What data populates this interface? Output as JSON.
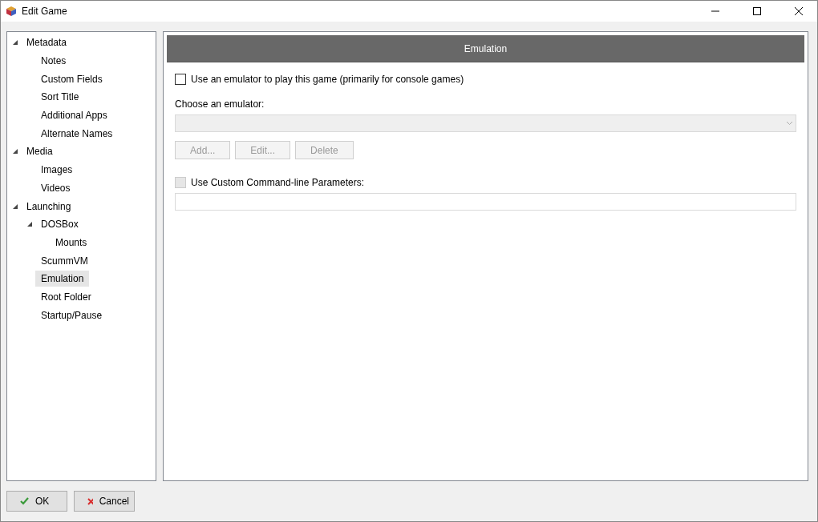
{
  "window": {
    "title": "Edit Game"
  },
  "tree": [
    {
      "label": "Metadata",
      "selected": false,
      "expanded": true,
      "children": [
        {
          "label": "Notes",
          "selected": false
        },
        {
          "label": "Custom Fields",
          "selected": false
        },
        {
          "label": "Sort Title",
          "selected": false
        },
        {
          "label": "Additional Apps",
          "selected": false
        },
        {
          "label": "Alternate Names",
          "selected": false
        }
      ]
    },
    {
      "label": "Media",
      "selected": false,
      "expanded": true,
      "children": [
        {
          "label": "Images",
          "selected": false
        },
        {
          "label": "Videos",
          "selected": false
        }
      ]
    },
    {
      "label": "Launching",
      "selected": false,
      "expanded": true,
      "children": [
        {
          "label": "DOSBox",
          "selected": false,
          "expanded": true,
          "children": [
            {
              "label": "Mounts",
              "selected": false
            }
          ]
        },
        {
          "label": "ScummVM",
          "selected": false
        },
        {
          "label": "Emulation",
          "selected": true
        },
        {
          "label": "Root Folder",
          "selected": false
        },
        {
          "label": "Startup/Pause",
          "selected": false
        }
      ]
    }
  ],
  "panel": {
    "header": "Emulation",
    "use_emulator": {
      "label": "Use an emulator to play this game (primarily for console games)",
      "checked": false,
      "disabled": false
    },
    "choose_label": "Choose an emulator:",
    "emulator_select": {
      "disabled": true
    },
    "buttons": [
      {
        "label": "Add...",
        "disabled": true
      },
      {
        "label": "Edit...",
        "disabled": true
      },
      {
        "label": "Delete",
        "disabled": true
      }
    ],
    "custom_params": {
      "label": "Use Custom Command-line Parameters:",
      "checked": false,
      "disabled": true
    }
  },
  "footer": [
    {
      "label": "OK",
      "kind": "ok"
    },
    {
      "label": "Cancel",
      "kind": "cancel"
    }
  ]
}
